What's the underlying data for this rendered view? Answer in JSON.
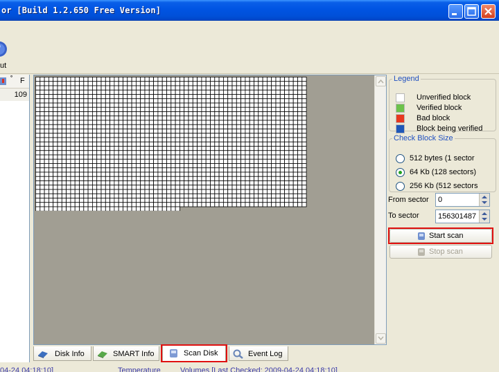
{
  "window": {
    "title": "or [Build 1.2.650 Free Version]",
    "buttons": [
      "minimize",
      "maximize",
      "close"
    ]
  },
  "toolbar": {
    "partial_label": "ut",
    "icon": "globe-icon"
  },
  "disk_list": {
    "header_deg": "˚",
    "header_f": "F",
    "rows": [
      {
        "value": "109"
      }
    ]
  },
  "scan_map": {
    "columns": 62,
    "total_rows": 31,
    "last_row_cells": 33,
    "block_color": "#FFFFFF",
    "grid_color": "#000000",
    "background": "#A19E93"
  },
  "legend": {
    "title": "Legend",
    "items": [
      {
        "label": "Unverified block",
        "color": "#FFFFFF"
      },
      {
        "label": "Verified block",
        "color": "#6CC24A"
      },
      {
        "label": "Bad block",
        "color": "#E8381E"
      },
      {
        "label": "Block being verified",
        "color": "#1F57B8"
      }
    ]
  },
  "block_size": {
    "title": "Check Block Size",
    "options": [
      {
        "label": "512 bytes (1 sector",
        "selected": false
      },
      {
        "label": "64 Kb (128 sectors)",
        "selected": true
      },
      {
        "label": "256 Kb (512 sectors",
        "selected": false
      }
    ]
  },
  "sectors": {
    "from_label": "From sector",
    "from_value": "0",
    "to_label": "To sector",
    "to_value": "156301487"
  },
  "buttons": {
    "start_scan": "Start scan",
    "stop_scan": "Stop scan"
  },
  "tabs": [
    {
      "label": "Disk Info",
      "icon": "disk-info-icon",
      "active": false
    },
    {
      "label": "SMART Info",
      "icon": "smart-info-icon",
      "active": false
    },
    {
      "label": "Scan Disk",
      "icon": "scan-disk-icon",
      "active": true
    },
    {
      "label": "Event Log",
      "icon": "event-log-icon",
      "active": false
    }
  ],
  "statusbar": {
    "left": "04-24 04:18:10]",
    "middle": "Temperature",
    "right": "Volumes [Last Checked: 2009-04-24 04:18:10]"
  },
  "colors": {
    "highlight": "#E01010",
    "legend_title": "#2050C0"
  }
}
